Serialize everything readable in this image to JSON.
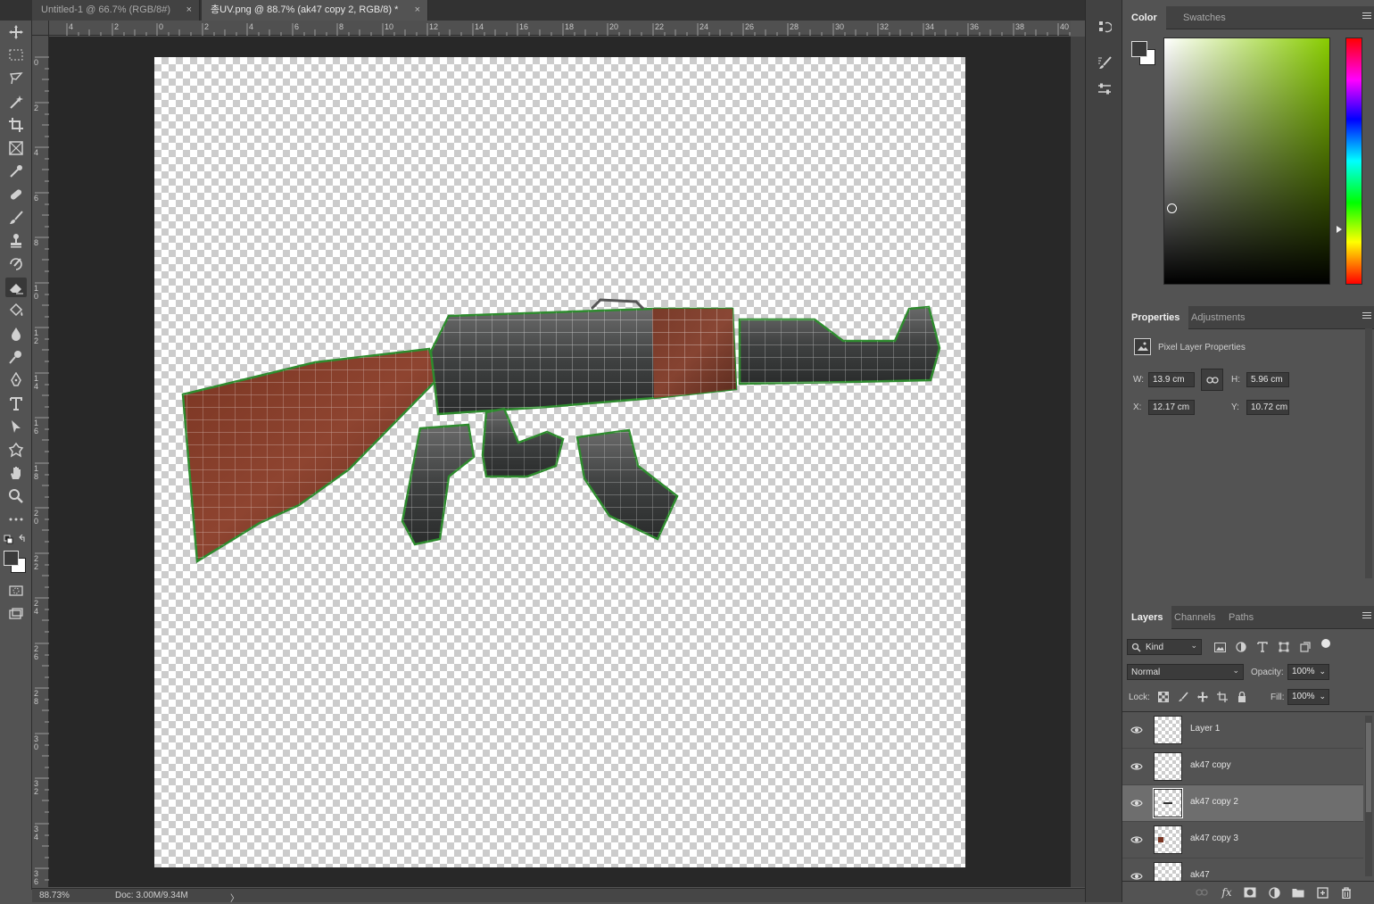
{
  "tabs": [
    {
      "label": "Untitled-1 @ 66.7% (RGB/8#)",
      "close": "×"
    },
    {
      "label": "총UV.png @ 88.7% (ak47 copy 2, RGB/8) *",
      "close": "×"
    }
  ],
  "rulers": {
    "top_ticks": [
      "4",
      "2",
      "0",
      "2",
      "4",
      "6",
      "8",
      "10",
      "12",
      "14",
      "16",
      "18",
      "20",
      "22",
      "24",
      "26",
      "28",
      "30",
      "32",
      "34",
      "36",
      "38",
      "40"
    ],
    "left_ticks": [
      "0",
      "2",
      "4",
      "6",
      "8",
      "10",
      "12",
      "14",
      "16",
      "18",
      "20",
      "22",
      "24",
      "26",
      "28",
      "30",
      "32",
      "34",
      "36"
    ]
  },
  "status": {
    "zoom": "88.73%",
    "doc": "Doc: 3.00M/9.34M",
    "arrow": "〉"
  },
  "color_panel": {
    "tabs": [
      "Color",
      "Swatches"
    ],
    "foreground": "#3b3b3b",
    "background": "#ffffff",
    "hue_color": "#88cc00"
  },
  "properties_panel": {
    "tabs": [
      "Properties",
      "Adjustments"
    ],
    "title": "Pixel Layer Properties",
    "w_label": "W:",
    "w_value": "13.9 cm",
    "h_label": "H:",
    "h_value": "5.96 cm",
    "x_label": "X:",
    "x_value": "12.17 cm",
    "y_label": "Y:",
    "y_value": "10.72 cm"
  },
  "layers_panel": {
    "tabs": [
      "Layers",
      "Channels",
      "Paths"
    ],
    "filter_kind": "Kind",
    "blend_mode": "Normal",
    "opacity_label": "Opacity:",
    "opacity_value": "100%",
    "lock_label": "Lock:",
    "fill_label": "Fill:",
    "fill_value": "100%",
    "layers": [
      {
        "name": "Layer 1",
        "selected": false
      },
      {
        "name": "ak47 copy",
        "selected": false
      },
      {
        "name": "ak47 copy 2",
        "selected": true
      },
      {
        "name": "ak47 copy 3",
        "selected": false
      },
      {
        "name": "ak47",
        "selected": false
      }
    ],
    "footer_icons": [
      "link-icon",
      "fx-icon",
      "mask-icon",
      "adjustment-icon",
      "group-icon",
      "new-layer-icon",
      "trash-icon"
    ]
  },
  "tools": [
    "move-tool-icon",
    "marquee-tool-icon",
    "lasso-tool-icon",
    "magic-wand-icon",
    "crop-tool-icon",
    "frame-tool-icon",
    "eyedropper-icon",
    "healing-brush-icon",
    "brush-tool-icon",
    "clone-stamp-icon",
    "history-brush-icon",
    "eraser-tool-icon",
    "paint-bucket-icon",
    "blur-tool-icon",
    "dodge-tool-icon",
    "pen-tool-icon",
    "type-tool-icon",
    "path-selection-icon",
    "custom-shape-icon",
    "hand-tool-icon",
    "zoom-tool-icon",
    "more-tools-icon"
  ]
}
